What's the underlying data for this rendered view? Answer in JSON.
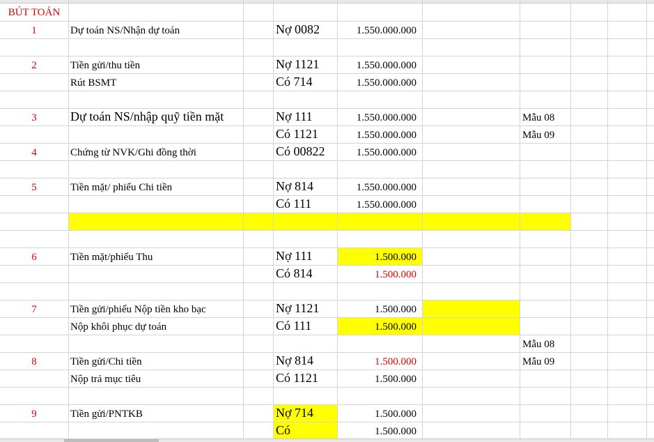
{
  "sheet": {
    "header": "BÚT TOÁN",
    "rows": {
      "r1": {
        "num": "1",
        "desc": "Dự toán NS/Nhận dự toán",
        "acct": "Nợ 0082",
        "amount": "1.550.000.000"
      },
      "r2": {
        "num": "2",
        "desc": "Tiền gửi/thu tiền",
        "acct": "Nợ 1121",
        "amount": "1.550.000.000"
      },
      "r2b": {
        "desc": "Rút BSMT",
        "acct": "Có 714",
        "amount": "1.550.000.000"
      },
      "r3": {
        "num": "3",
        "desc": "Dự toán NS/nhập quỹ tiền mặt",
        "acct": "Nợ 111",
        "amount": "1.550.000.000",
        "form": "Mẫu 08"
      },
      "r3b": {
        "acct": "Có 1121",
        "amount": "1.550.000.000",
        "form": "Mẫu 09"
      },
      "r4": {
        "num": "4",
        "desc": "Chứng từ NVK/Ghi đồng thời",
        "acct": "Có 00822",
        "amount": "1.550.000.000"
      },
      "r5": {
        "num": "5",
        "desc": "Tiền mặt/ phiếu Chi tiền",
        "acct": "Nợ 814",
        "amount": "1.550.000.000"
      },
      "r5b": {
        "acct": "Có 111",
        "amount": "1.550.000.000"
      },
      "r6": {
        "num": "6",
        "desc": "Tiền mặt/phiếu Thu",
        "acct": "Nợ 111",
        "amount": "1.500.000"
      },
      "r6b": {
        "acct": "Có 814",
        "amount": "1.500.000"
      },
      "r7": {
        "num": "7",
        "desc": "Tiền gửi/phiếu Nộp tiền kho bạc",
        "acct": "Nợ 1121",
        "amount": "1.500.000"
      },
      "r7b": {
        "desc": "Nộp khôi phục dự toán",
        "acct": "Có 111",
        "amount": "1.500.000"
      },
      "r8a": {
        "form": "Mẫu 08"
      },
      "r8": {
        "num": "8",
        "desc": "Tiền gửi/Chi tiền",
        "acct": "Nợ 814",
        "amount": "1.500.000",
        "form": "Mẫu 09"
      },
      "r8b": {
        "desc": "Nộp trả mục tiêu",
        "acct": "Có 1121",
        "amount": "1.500.000"
      },
      "r9": {
        "num": "9",
        "desc": "Tiền gửi/PNTKB",
        "acct": "Nợ 714",
        "amount": "1.500.000"
      },
      "r9b": {
        "acct": "Có",
        "amount": "1.500.000"
      }
    }
  },
  "colors": {
    "highlight": "#ffff00",
    "red_text": "#e00000",
    "gridline": "#d4d4d4"
  }
}
